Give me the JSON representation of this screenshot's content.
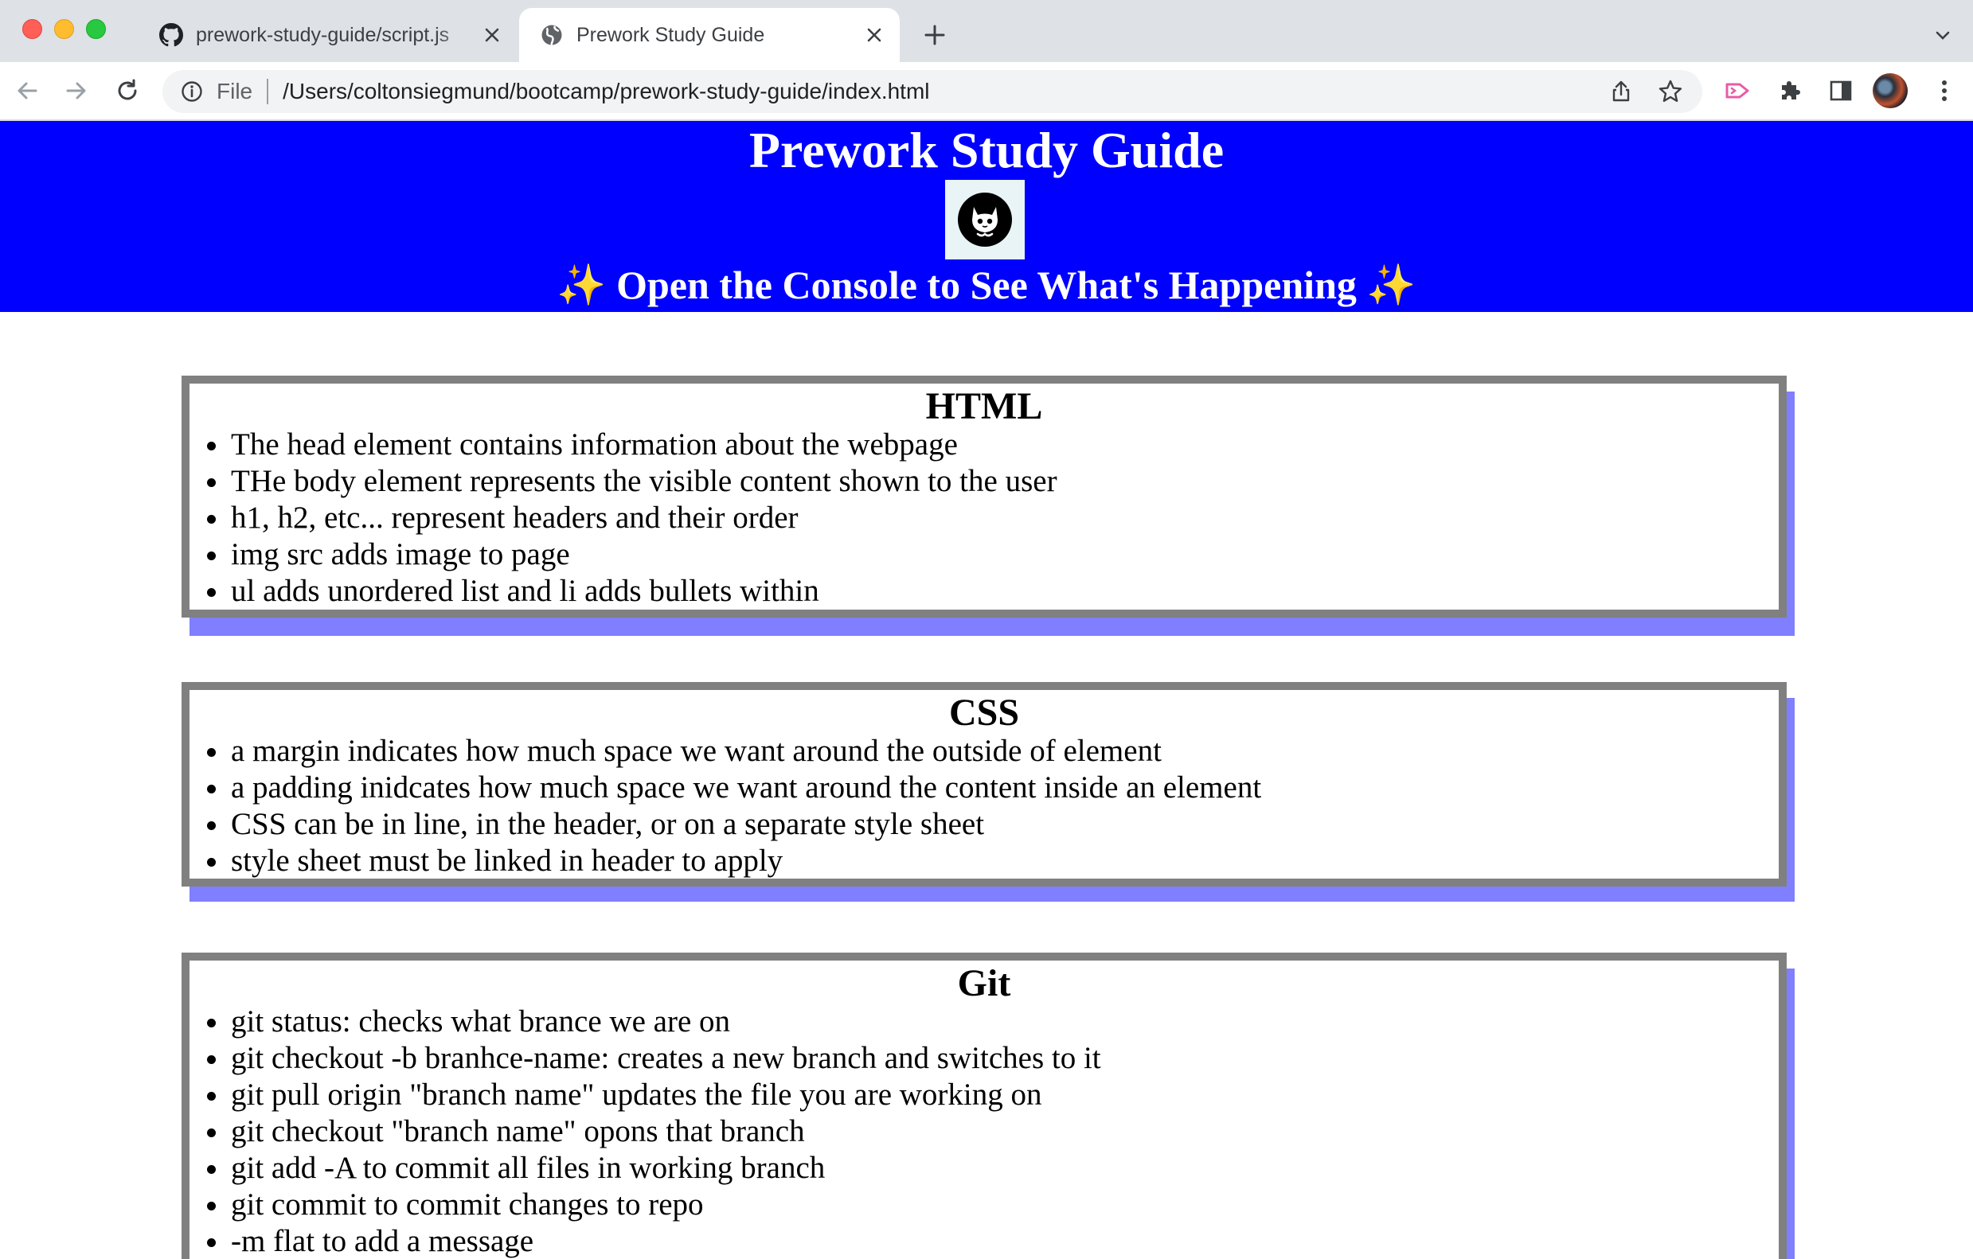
{
  "browser": {
    "tabs": [
      {
        "title": "prework-study-guide/script.js",
        "icon": "github-icon",
        "active": false
      },
      {
        "title": "Prework Study Guide",
        "icon": "globe-icon",
        "active": true
      }
    ],
    "omnibox": {
      "scheme_label": "File",
      "url": "/Users/coltonsiegmund/bootcamp/prework-study-guide/index.html"
    }
  },
  "page": {
    "title": "Prework Study Guide",
    "subtitle": "Open the Console to See What's Happening",
    "sparkle": "✨",
    "sections": [
      {
        "heading": "HTML",
        "items": [
          "The head element contains information about the webpage",
          "THe body element represents the visible content shown to the user",
          "h1, h2, etc... represent headers and their order",
          "img src adds image to page",
          "ul adds unordered list and li adds bullets within"
        ]
      },
      {
        "heading": "CSS",
        "items": [
          "a margin indicates how much space we want around the outside of element",
          "a padding inidcates how much space we want around the content inside an element",
          "CSS can be in line, in the header, or on a separate style sheet",
          "style sheet must be linked in header to apply"
        ]
      },
      {
        "heading": "Git",
        "items": [
          "git status: checks what brance we are on",
          "git checkout -b branhce-name: creates a new branch and switches to it",
          "git pull origin \"branch name\" updates the file you are working on",
          "git checkout \"branch name\" opons that branch",
          "git add -A to commit all files in working branch",
          "git commit to commit changes to repo",
          "-m flat to add a message"
        ]
      }
    ]
  },
  "colors": {
    "hero_bg": "#0000ff",
    "card_border": "#808080",
    "card_shadow": "#7f7fff"
  }
}
